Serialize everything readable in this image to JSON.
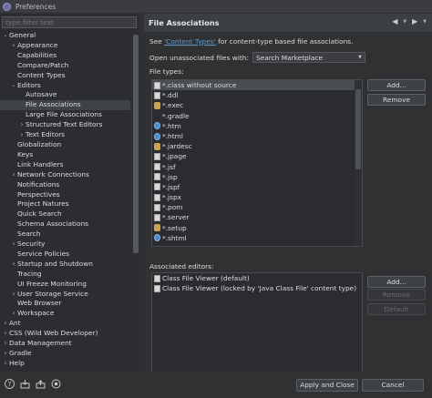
{
  "window": {
    "title": "Preferences"
  },
  "filter": {
    "placeholder": "type filter text"
  },
  "tree": [
    {
      "label": "General",
      "indent": 0,
      "arrow": "down"
    },
    {
      "label": "Appearance",
      "indent": 1,
      "arrow": "right"
    },
    {
      "label": "Capabilities",
      "indent": 1,
      "arrow": ""
    },
    {
      "label": "Compare/Patch",
      "indent": 1,
      "arrow": ""
    },
    {
      "label": "Content Types",
      "indent": 1,
      "arrow": ""
    },
    {
      "label": "Editors",
      "indent": 1,
      "arrow": "down"
    },
    {
      "label": "Autosave",
      "indent": 2,
      "arrow": ""
    },
    {
      "label": "File Associations",
      "indent": 2,
      "arrow": "",
      "selected": true
    },
    {
      "label": "Large File Associations",
      "indent": 2,
      "arrow": ""
    },
    {
      "label": "Structured Text Editors",
      "indent": 2,
      "arrow": "right"
    },
    {
      "label": "Text Editors",
      "indent": 2,
      "arrow": "right"
    },
    {
      "label": "Globalization",
      "indent": 1,
      "arrow": ""
    },
    {
      "label": "Keys",
      "indent": 1,
      "arrow": ""
    },
    {
      "label": "Link Handlers",
      "indent": 1,
      "arrow": ""
    },
    {
      "label": "Network Connections",
      "indent": 1,
      "arrow": "right"
    },
    {
      "label": "Notifications",
      "indent": 1,
      "arrow": ""
    },
    {
      "label": "Perspectives",
      "indent": 1,
      "arrow": ""
    },
    {
      "label": "Project Natures",
      "indent": 1,
      "arrow": ""
    },
    {
      "label": "Quick Search",
      "indent": 1,
      "arrow": ""
    },
    {
      "label": "Schema Associations",
      "indent": 1,
      "arrow": ""
    },
    {
      "label": "Search",
      "indent": 1,
      "arrow": ""
    },
    {
      "label": "Security",
      "indent": 1,
      "arrow": "right"
    },
    {
      "label": "Service Policies",
      "indent": 1,
      "arrow": ""
    },
    {
      "label": "Startup and Shutdown",
      "indent": 1,
      "arrow": "right"
    },
    {
      "label": "Tracing",
      "indent": 1,
      "arrow": ""
    },
    {
      "label": "UI Freeze Monitoring",
      "indent": 1,
      "arrow": ""
    },
    {
      "label": "User Storage Service",
      "indent": 1,
      "arrow": "right"
    },
    {
      "label": "Web Browser",
      "indent": 1,
      "arrow": ""
    },
    {
      "label": "Workspace",
      "indent": 1,
      "arrow": "right"
    },
    {
      "label": "Ant",
      "indent": 0,
      "arrow": "right"
    },
    {
      "label": "CSS (Wild Web Developer)",
      "indent": 0,
      "arrow": "right"
    },
    {
      "label": "Data Management",
      "indent": 0,
      "arrow": "right"
    },
    {
      "label": "Gradle",
      "indent": 0,
      "arrow": "right"
    },
    {
      "label": "Help",
      "indent": 0,
      "arrow": "right"
    }
  ],
  "page": {
    "title": "File Associations",
    "see_prefix": "See ",
    "see_link": "'Content Types'",
    "see_suffix": " for content-type based file associations.",
    "open_label": "Open unassociated files with:",
    "open_value": "Search Marketplace",
    "file_types_label": "File types:",
    "assoc_label": "Associated editors:"
  },
  "file_types": [
    {
      "name": "*.class without source",
      "icon": "page",
      "selected": true
    },
    {
      "name": "*.ddl",
      "icon": "page"
    },
    {
      "name": "*.exec",
      "icon": "gear"
    },
    {
      "name": "*.gradle",
      "icon": "blank"
    },
    {
      "name": "*.htm",
      "icon": "globe"
    },
    {
      "name": "*.html",
      "icon": "globe"
    },
    {
      "name": "*.jardesc",
      "icon": "gear"
    },
    {
      "name": "*.jpage",
      "icon": "page"
    },
    {
      "name": "*.jsf",
      "icon": "page"
    },
    {
      "name": "*.jsp",
      "icon": "page"
    },
    {
      "name": "*.jspf",
      "icon": "page"
    },
    {
      "name": "*.jspx",
      "icon": "page"
    },
    {
      "name": "*.pom",
      "icon": "page"
    },
    {
      "name": "*.server",
      "icon": "page"
    },
    {
      "name": "*.setup",
      "icon": "gear"
    },
    {
      "name": "*.shtml",
      "icon": "globe"
    }
  ],
  "editors": [
    {
      "name": "Class File Viewer (default)"
    },
    {
      "name": "Class File Viewer (locked by 'Java Class File' content type)"
    }
  ],
  "buttons": {
    "add_type": "Add...",
    "remove_type": "Remove",
    "add_editor": "Add...",
    "remove_editor": "Remove",
    "default_editor": "Default",
    "apply_close": "Apply and Close",
    "cancel": "Cancel"
  },
  "icons": {
    "back": "◀",
    "forward": "▶",
    "dropdown": "▼",
    "help": "?"
  }
}
